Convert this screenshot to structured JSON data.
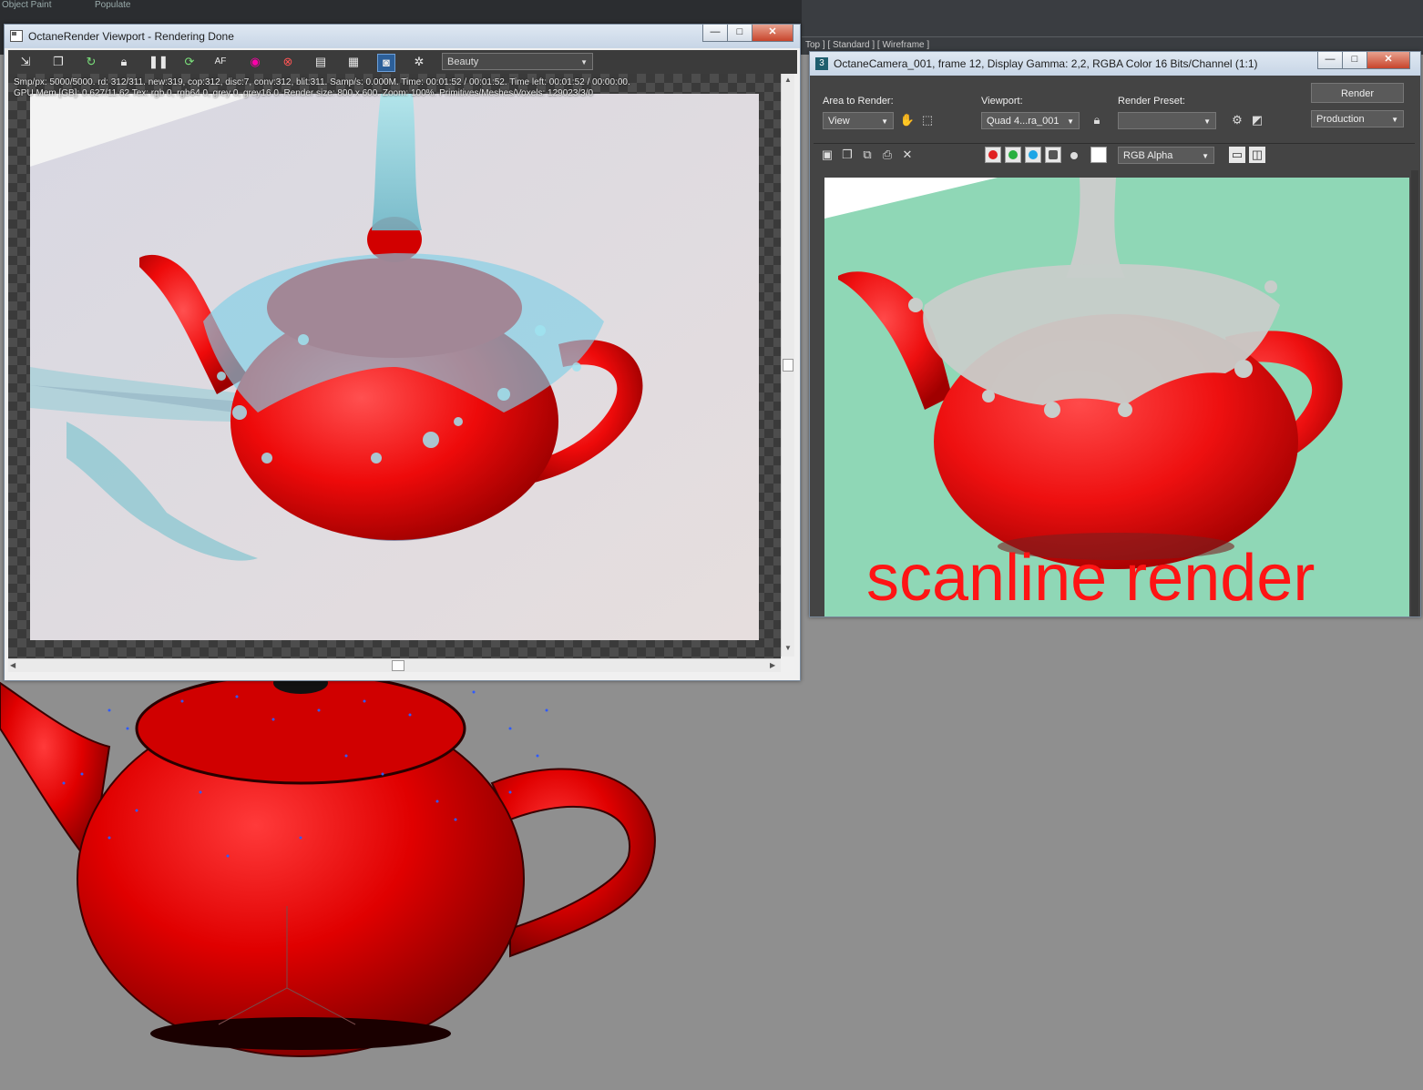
{
  "background": {
    "viewport_label": "Top ] [ Standard ] [ Wireframe ]",
    "top_left_labels": [
      "Object Paint",
      "Populate"
    ]
  },
  "octane": {
    "title": "OctaneRender Viewport - Rendering Done",
    "pass_dropdown": "Beauty",
    "stats_line1": "Smp/px: 5000/5000.   rd: 312/311.   new:319, cop:312, disc:7, conv:312, blit:311.   Samp/s: 0.000M.   Time: 00:01:52 / 00:01:52.   Time left: 00:01:52 / 00:00:00.",
    "stats_line2": "GPU Mem [GB]: 0.627/11.62   Tex: rgb 0, rgb64 0, grey 0, grey16 0.   Render size: 800 x 600.   Zoom: 100%.   Primitives/Meshes/Voxels: 129023/3/0",
    "toolbar_icons": [
      "export-icon",
      "copy-icon",
      "restart-icon",
      "lock-icon",
      "pause-icon",
      "refresh-icon",
      "autofocus-icon",
      "color-picker-icon",
      "render-region-icon",
      "film-icon",
      "settings-icon",
      "camera-icon",
      "gear-icon"
    ],
    "window_buttons": [
      "—",
      "□",
      "✕"
    ]
  },
  "framebuffer": {
    "title": "OctaneCamera_001, frame 12, Display Gamma: 2,2, RGBA Color 16 Bits/Channel (1:1)",
    "window_icon": "3",
    "area_label": "Area to Render:",
    "area_value": "View",
    "viewport_label": "Viewport:",
    "viewport_value": "Quad 4...ra_001",
    "preset_label": "Render Preset:",
    "preset_value": "",
    "render_button": "Render",
    "production_value": "Production",
    "channel_value": "RGB Alpha",
    "overlay_text": "scanline render",
    "channels": {
      "red": "#e02020",
      "green": "#28b040",
      "blue": "#1ea6e6"
    },
    "window_buttons": [
      "—",
      "□",
      "✕"
    ]
  }
}
